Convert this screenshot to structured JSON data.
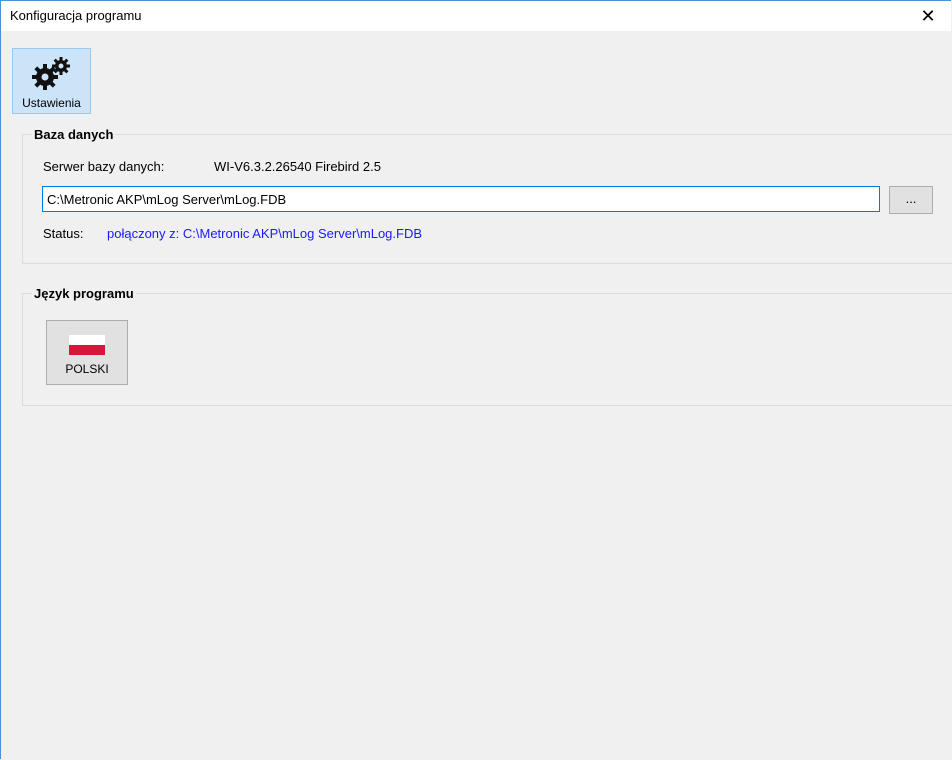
{
  "window": {
    "title": "Konfiguracja programu",
    "close_glyph": "✕"
  },
  "toolbar": {
    "settings_label": "Ustawienia",
    "settings_icon": "gears-icon"
  },
  "database": {
    "legend": "Baza danych",
    "server_label": "Serwer bazy danych:",
    "server_value": "WI-V6.3.2.26540 Firebird 2.5",
    "path_value": "C:\\Metronic AKP\\mLog Server\\mLog.FDB",
    "browse_label": "...",
    "status_label": "Status:",
    "status_value": "połączony z: C:\\Metronic AKP\\mLog Server\\mLog.FDB",
    "status_color": "#1a1aff"
  },
  "language": {
    "legend": "Język programu",
    "button_label": "POLSKI",
    "flag_icon": "poland-flag-icon",
    "flag_colors": [
      "#ffffff",
      "#dc143c"
    ]
  }
}
